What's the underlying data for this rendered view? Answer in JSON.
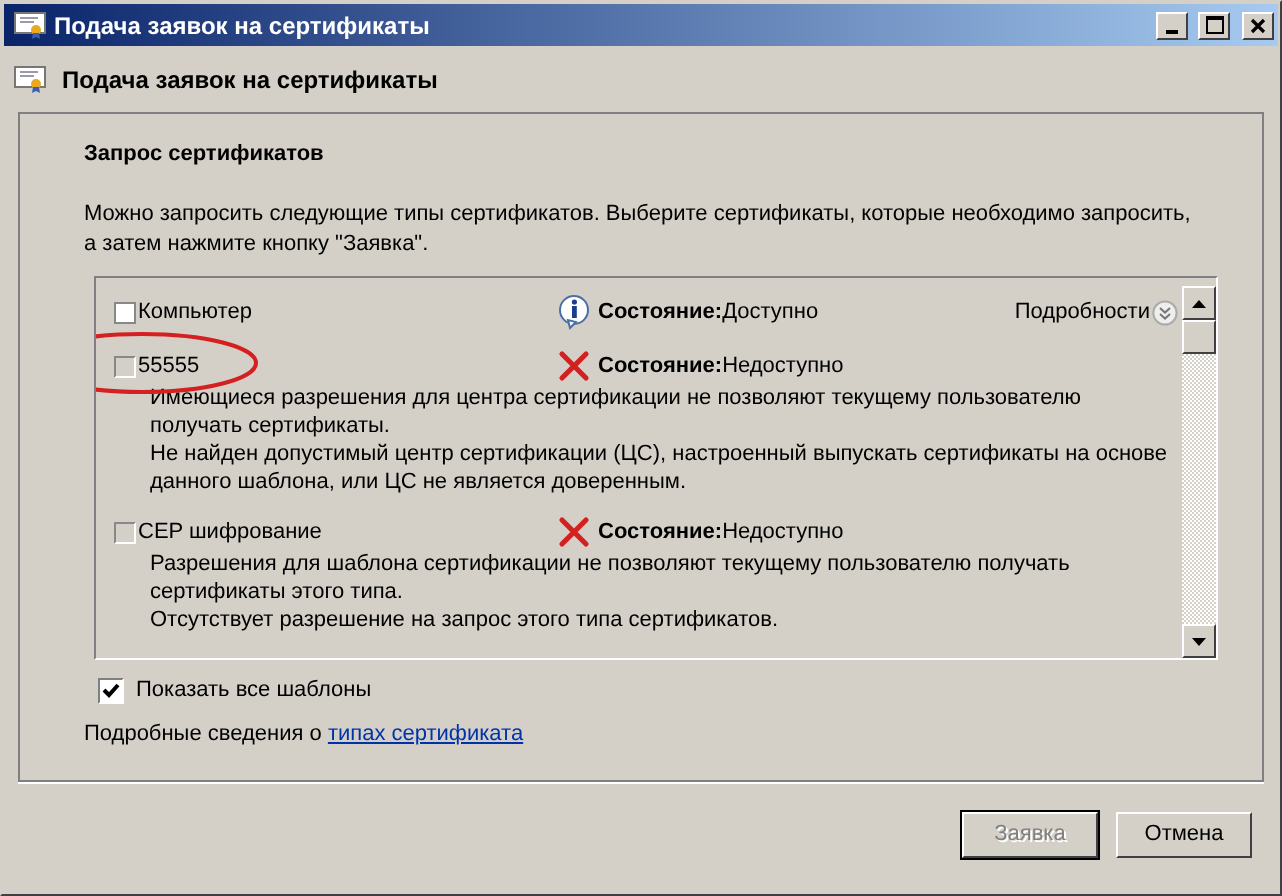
{
  "window": {
    "title": "Подача заявок на сертификаты"
  },
  "header": {
    "title": "Подача заявок на сертификаты"
  },
  "section": {
    "title": "Запрос сертификатов",
    "description": "Можно запросить следующие типы сертификатов. Выберите сертификаты, которые необходимо запросить, а затем нажмите кнопку \"Заявка\"."
  },
  "certificates": [
    {
      "name": "Компьютер",
      "checked": false,
      "disabled": false,
      "highlighted": false,
      "kind": "info",
      "status_label": "Состояние:",
      "status": "Доступно",
      "details": "Подробности"
    },
    {
      "name": "55555",
      "checked": false,
      "disabled": true,
      "highlighted": true,
      "kind": "error",
      "status_label": "Состояние:",
      "status": "Недоступно",
      "lines": [
        "Имеющиеся разрешения для центра сертификации не позволяют текущему пользователю получать сертификаты.",
        "Не найден допустимый центр сертификации (ЦС), настроенный выпускать сертификаты на основе данного шаблона, или ЦС не является доверенным."
      ]
    },
    {
      "name": "CEP шифрование",
      "checked": false,
      "disabled": true,
      "highlighted": false,
      "kind": "error",
      "status_label": "Состояние:",
      "status": "Недоступно",
      "lines": [
        "Разрешения для шаблона сертификации не позволяют текущему пользователю получать сертификаты этого типа.",
        "Отсутствует разрешение на запрос этого типа сертификатов."
      ]
    }
  ],
  "show_all": {
    "label": "Показать все шаблоны",
    "checked": true
  },
  "more_info": {
    "text": "Подробные сведения о",
    "link": "типах сертификата"
  },
  "buttons": [
    {
      "label": "Заявка",
      "disabled": true
    },
    {
      "label": "Отмена",
      "disabled": false
    }
  ]
}
